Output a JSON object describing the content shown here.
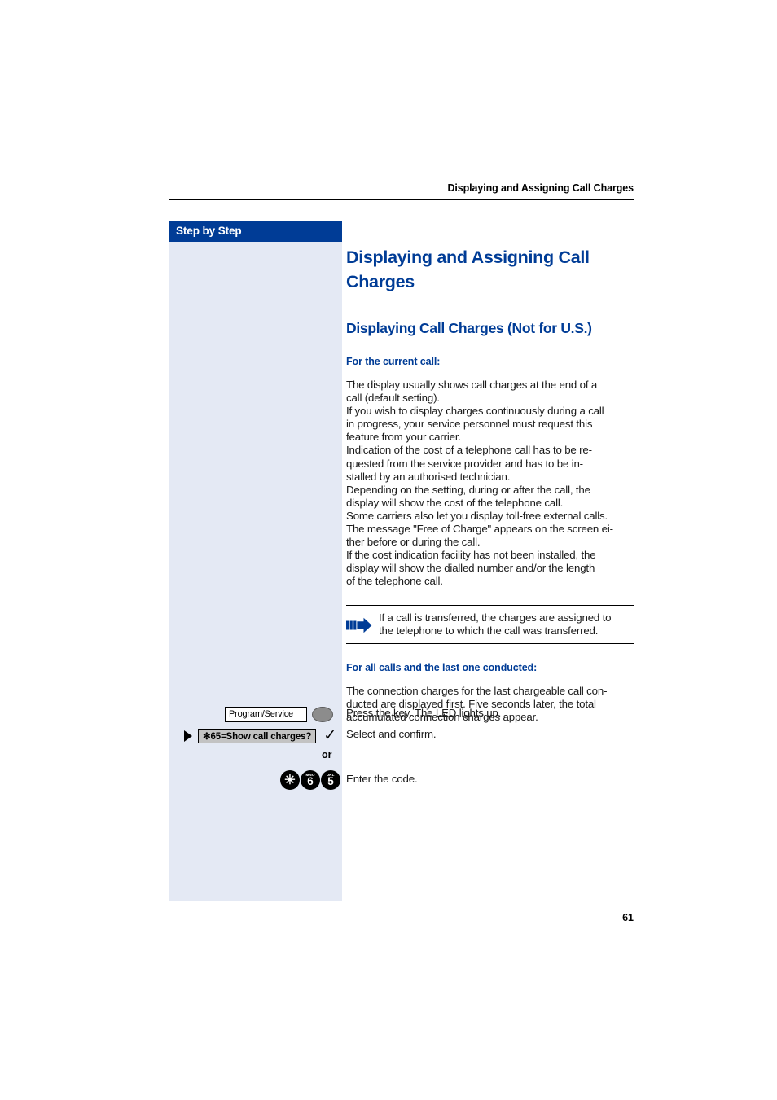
{
  "header": {
    "running_title": "Displaying and Assigning Call Charges"
  },
  "sidebar": {
    "title": "Step by Step",
    "background_color": "#e4e9f4",
    "title_bar_color": "#003c96"
  },
  "main": {
    "title": "Displaying and Assigning Call Charges",
    "subtitle": "Displaying Call Charges (Not for U.S.)",
    "section_1": {
      "heading": "For the current call:",
      "paragraph_lines": [
        "The display usually shows call charges at the end of a",
        "call (default setting).",
        "If you wish to display charges continuously during a call",
        "in progress, your service personnel must request this",
        "feature from your carrier.",
        "Indication of the cost of a telephone call has to be re-",
        "quested from the service provider and has to be in-",
        "stalled by an authorised technician.",
        "Depending on the setting, during or after the call, the",
        "display will show the cost of the telephone call.",
        "Some carriers also let you display toll-free external calls.",
        "The message \"Free of Charge\" appears on the screen ei-",
        "ther before or during the call.",
        "If the cost indication facility has not been installed, the",
        "display will show the dialled number and/or the length",
        "of the telephone call."
      ]
    },
    "note": {
      "icon": "arrow-note-icon",
      "lines": [
        "If a call is transferred, the charges are assigned to",
        "the telephone to which the call was transferred."
      ]
    },
    "section_2": {
      "heading": "For all calls and the last one conducted:",
      "paragraph_lines": [
        "The connection charges for the last chargeable call con-",
        "ducted are displayed first. Five seconds later, the total",
        "accumulated connection charges appear."
      ]
    }
  },
  "steps": [
    {
      "key_label": "Program/Service",
      "description": "Press the key. The LED lights up."
    },
    {
      "option_label": "✻65=Show call charges?",
      "description": "Select and confirm."
    },
    {
      "separator": "or"
    },
    {
      "keys": [
        {
          "letters": "",
          "digit": "✳"
        },
        {
          "letters": "MNO",
          "digit": "6"
        },
        {
          "letters": "JKL",
          "digit": "5"
        }
      ],
      "description": "Enter the code."
    }
  ],
  "footer": {
    "page_number": "61"
  },
  "colors": {
    "heading_blue": "#003c96",
    "sidebar_fill": "#e4e9f4",
    "body_text": "#1a1a1a",
    "option_box_fill": "#c3c3c3",
    "led_fill": "#8c8c8c"
  }
}
